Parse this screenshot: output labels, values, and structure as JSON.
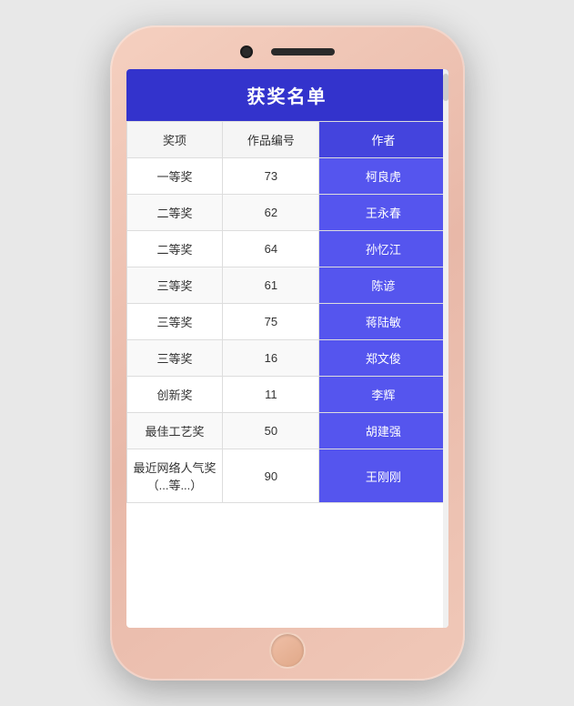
{
  "phone": {
    "title": "获奖名单"
  },
  "table": {
    "headers": {
      "prize": "奖项",
      "work_id": "作品编号",
      "author": "作者"
    },
    "rows": [
      {
        "prize": "一等奖",
        "work_id": "73",
        "author": "柯良虎"
      },
      {
        "prize": "二等奖",
        "work_id": "62",
        "author": "王永春"
      },
      {
        "prize": "二等奖",
        "work_id": "64",
        "author": "孙忆江"
      },
      {
        "prize": "三等奖",
        "work_id": "61",
        "author": "陈谚"
      },
      {
        "prize": "三等奖",
        "work_id": "75",
        "author": "蒋陆敏"
      },
      {
        "prize": "三等奖",
        "work_id": "16",
        "author": "郑文俊"
      },
      {
        "prize": "创新奖",
        "work_id": "11",
        "author": "李辉"
      },
      {
        "prize": "最佳工艺奖",
        "work_id": "50",
        "author": "胡建强"
      },
      {
        "prize": "最近网络人气奖（...等...）",
        "work_id": "90",
        "author": "王刚刚"
      }
    ]
  }
}
